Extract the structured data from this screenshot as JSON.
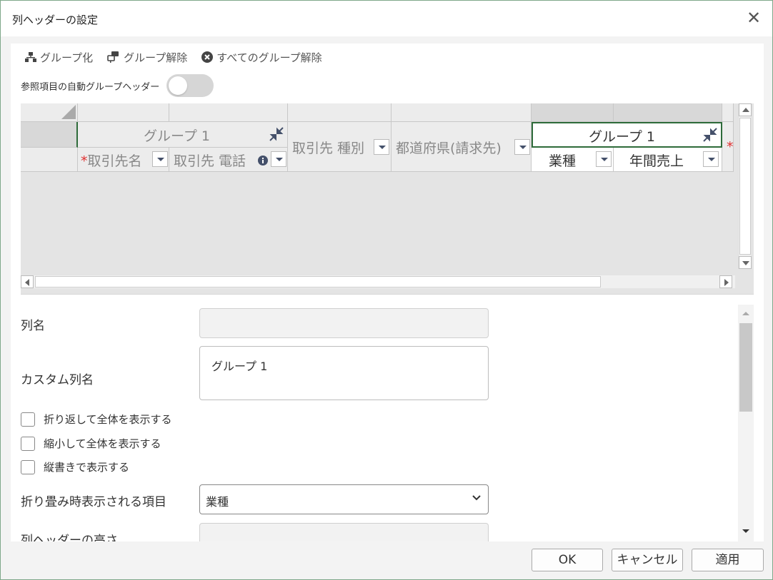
{
  "window": {
    "title": "列ヘッダーの設定",
    "close_glyph": "✕"
  },
  "toolbar": {
    "group_label": "グループ化",
    "ungroup_label": "グループ解除",
    "ungroup_all_label": "すべてのグループ解除"
  },
  "auto_group": {
    "label": "参照項目の自動グループヘッダー",
    "enabled": false
  },
  "grid": {
    "group1_label": "グループ 1",
    "group2_label": "グループ 1",
    "required_mark": "*",
    "columns": [
      {
        "label": "取引先名",
        "required": true
      },
      {
        "label": "取引先 電話",
        "info_icon": true
      },
      {
        "label": "取引先 種別"
      },
      {
        "label": "都道府県(請求先)"
      },
      {
        "label": "業種"
      },
      {
        "label": "年間売上"
      }
    ],
    "selected_border_color": "#2e6b3a"
  },
  "form": {
    "column_name_label": "列名",
    "column_name_value": "",
    "custom_name_label": "カスタム列名",
    "custom_name_value": "グループ 1",
    "wrap_label": "折り返して全体を表示する",
    "shrink_label": "縮小して全体を表示する",
    "vertical_label": "縦書きで表示する",
    "collapsed_item_label": "折り畳み時表示される項目",
    "collapsed_item_value": "業種",
    "header_height_label": "列ヘッダーの高さ"
  },
  "footer": {
    "ok_label": "OK",
    "cancel_label": "キャンセル",
    "apply_label": "適用"
  }
}
